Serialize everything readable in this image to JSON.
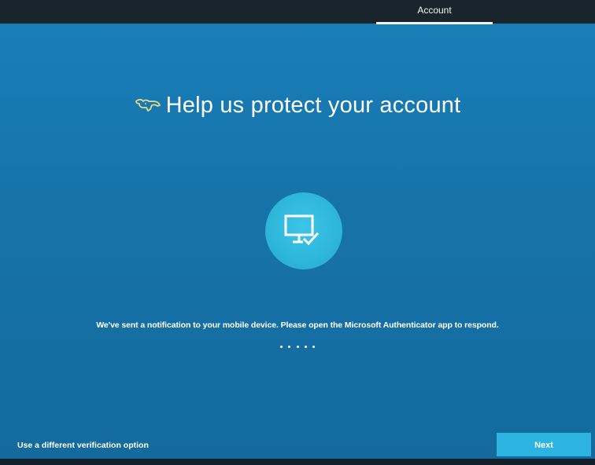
{
  "header": {
    "tab_label": "Account"
  },
  "main": {
    "title": "Help us protect your account",
    "message": "We've sent a notification to your mobile device. Please open the Microsoft Authenticator app to respond.",
    "device_icon": "monitor-check-icon",
    "progress_icon": "dots-progress-icon",
    "brand_icon": "bull-logo-icon"
  },
  "footer": {
    "alt_option_label": "Use a different verification option",
    "next_label": "Next"
  },
  "colors": {
    "background": "#1673aa",
    "accent": "#2cb3e0",
    "circle": "#2fb7dc",
    "brand_icon": "#e8d98a"
  }
}
